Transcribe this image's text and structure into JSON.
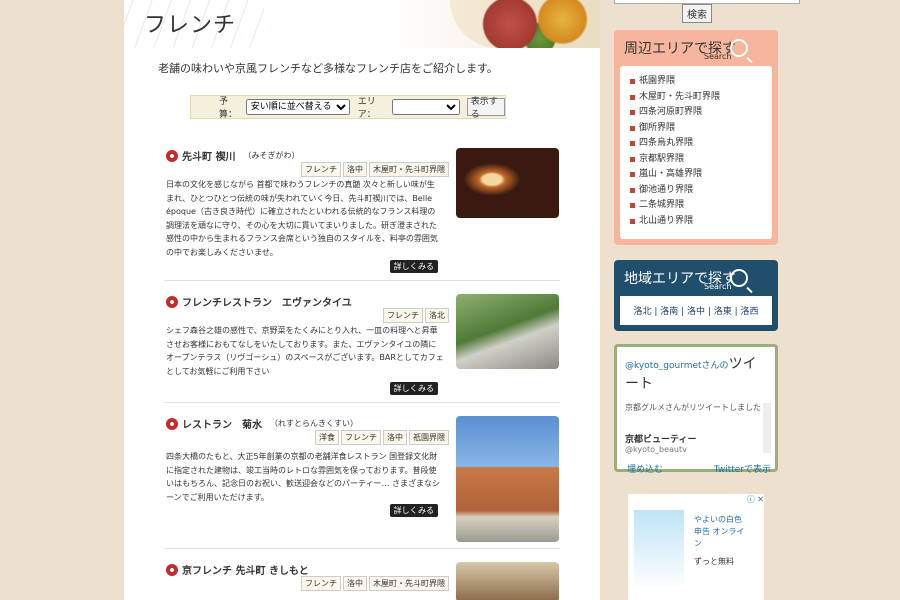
{
  "header": {
    "title": "フレンチ"
  },
  "intro": "老舗の味わいや京風フレンチなど多様なフレンチ店をご紹介します。",
  "filter": {
    "budget_label": "予算：",
    "budget_value": "安い順に並べ替える",
    "area_label": "エリア：",
    "area_value": "",
    "submit": "表示する"
  },
  "entries": [
    {
      "name": "先斗町 禊川",
      "kana": "（みそぎがわ）",
      "tags": [
        "フレンチ",
        "洛中",
        "木屋町・先斗町界隈"
      ],
      "desc": "日本の文化を感じながら 首都で味わうフレンチの真髄 次々と新しい味が生まれ、ひとつひとつ伝統の味が失われていく今日、先斗町禊川では、Belle époque（古き良き時代）に確立されたといわれる伝統的なフランス料理の調理法を頑なに守り、その心を大切に貫いてまいりました。研ぎ澄まされた感性の中から生まれるフランス会席という独自のスタイルを、料亭の雰囲気の中でお楽しみくださいませ。",
      "more": "詳しくみる"
    },
    {
      "name": "フレンチレストラン　エヴァンタイユ",
      "kana": "",
      "tags": [
        "フレンチ",
        "洛北"
      ],
      "desc": "シェフ森谷之雄の感性で、京野菜をたくみにとり入れ、一皿の料理へと昇華させお客様におもてなしをいたしております。また、エヴァンタイユの隣にオープンテラス（リヴゴーシュ）のスペースがございます。BARとしてカフェとしてお気軽にご利用下さい",
      "more": "詳しくみる"
    },
    {
      "name": "レストラン　菊水",
      "kana": "（れすとらんきくすい）",
      "tags": [
        "洋食",
        "フレンチ",
        "洛中",
        "祇園界隈"
      ],
      "desc": "四条大橋のたもと、大正5年創業の京都の老舗洋食レストラン 国登録文化財に指定された建物は、竣工当時のレトロな雰囲気を保っております。普段使いはもちろん、記念日のお祝い、歓送迎会などのパーティー… さまざまなシーンでご利用いただけます。",
      "more": "詳しくみる"
    },
    {
      "name": "京フレンチ 先斗町 きしもと",
      "kana": "",
      "tags": [
        "フレンチ",
        "洛中",
        "木屋町・先斗町界隈"
      ],
      "desc": "",
      "more": ""
    }
  ],
  "sidebar": {
    "search_button": "検索",
    "area_box": {
      "title": "周辺エリアで探す",
      "sub": "Search",
      "items": [
        "祇園界隈",
        "木屋町・先斗町界隈",
        "四条河原町界隈",
        "御所界隈",
        "四条烏丸界隈",
        "京都駅界隈",
        "嵐山・高雄界隈",
        "御池通り界隈",
        "二条城界隈",
        "北山通り界隈"
      ]
    },
    "region_box": {
      "title": "地域エリアで探す",
      "sub": "Search",
      "links": "洛北 | 洛南 | 洛中 | 洛東 | 洛西"
    },
    "twitter": {
      "handle": "@kyoto_gourmetさんの",
      "title": "ツイート",
      "retweet": "京都グルメさんがリツイートしました",
      "account": "京都ビューティー",
      "account_handle": "@kyoto_beautv",
      "embed": "埋め込む",
      "view": "Twitterで表示"
    },
    "ad": {
      "line1": "やよいの白色",
      "line2": "申告 オンライ",
      "line3": "ン",
      "line4": "ずっと無料",
      "badge": "ⓘ ✕"
    }
  },
  "colors": {
    "accent_red": "#c62a2a",
    "area_pink": "#f6b59c",
    "region_blue": "#1f4f6b",
    "twitter_green": "#9ab07a"
  }
}
